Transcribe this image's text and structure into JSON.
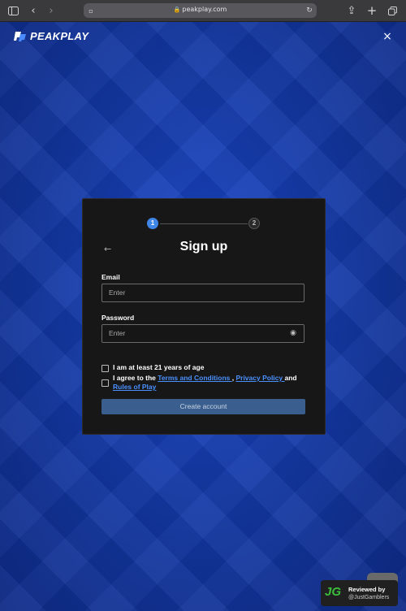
{
  "browser": {
    "url": "peakplay.com",
    "icons": [
      "sidebar-icon",
      "back-icon",
      "forward-icon",
      "page-icon",
      "lock-icon",
      "reload-icon",
      "share-icon",
      "new-tab-icon",
      "tabs-icon"
    ]
  },
  "brand": {
    "name": "PEAKPLAY",
    "accent": "#3f86e6"
  },
  "modal": {
    "steps": [
      "1",
      "2"
    ],
    "back_glyph": "←",
    "title": "Sign up",
    "email": {
      "label": "Email",
      "placeholder": "Enter"
    },
    "password": {
      "label": "Password",
      "placeholder": "Enter"
    },
    "age_check": "I am at least 21 years of age",
    "agree": {
      "prefix": "I agree to the ",
      "terms": "Terms and Conditions ",
      "sep": ", ",
      "privacy": "Privacy Policy ",
      "and": "and",
      "rules": "Rules of Play"
    },
    "create_button": "Create account"
  },
  "review_badge": {
    "logo": "JG",
    "title": "Reviewed by",
    "handle": "@JustGamblers"
  },
  "close_glyph": "×"
}
